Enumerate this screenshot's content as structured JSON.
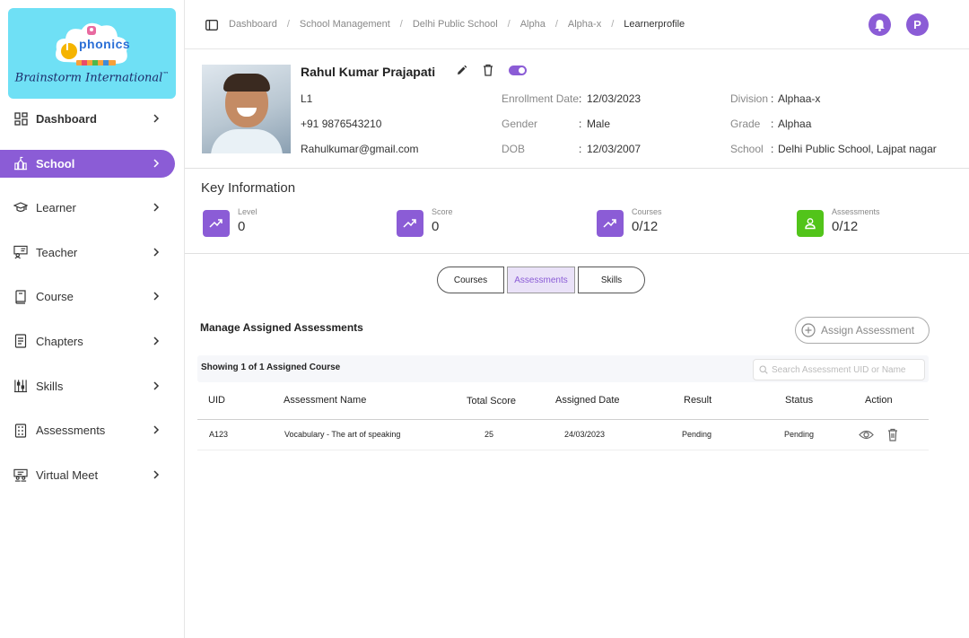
{
  "brand": {
    "logo_text": "phonics",
    "logo_initial": "I",
    "name": "Brainstorm International",
    "trademark": "™"
  },
  "sidebar": {
    "items": [
      {
        "label": "Dashboard",
        "icon": "dashboard-grid-icon"
      },
      {
        "label": "School",
        "icon": "school-building-icon",
        "active": true
      },
      {
        "label": "Learner",
        "icon": "graduation-cap-icon"
      },
      {
        "label": "Teacher",
        "icon": "teacher-board-icon"
      },
      {
        "label": "Course",
        "icon": "book-icon"
      },
      {
        "label": "Chapters",
        "icon": "document-icon"
      },
      {
        "label": "Skills",
        "icon": "abacus-icon"
      },
      {
        "label": "Assessments",
        "icon": "assessment-sheet-icon"
      },
      {
        "label": "Virtual Meet",
        "icon": "meeting-icon"
      }
    ]
  },
  "breadcrumb": {
    "items": [
      "Dashboard",
      "School Management",
      "Delhi Public School",
      "Alpha",
      "Alpha-x"
    ],
    "current": "Learnerprofile",
    "separator": "/"
  },
  "header": {
    "avatar_initial": "P"
  },
  "profile": {
    "name": "Rahul Kumar Prajapati",
    "level": "L1",
    "phone": "+91 9876543210",
    "email": "Rahulkumar@gmail.com",
    "enrollment_label": "Enrollment Date",
    "enrollment_value": "12/03/2023",
    "gender_label": "Gender",
    "gender_value": "Male",
    "dob_label": "DOB",
    "dob_value": "12/03/2007",
    "division_label": "Division",
    "division_value": "Alphaa-x",
    "grade_label": "Grade",
    "grade_value": "Alphaa",
    "school_label": "School",
    "school_value": "Delhi Public School, Lajpat nagar",
    "colon": ":",
    "active_toggle": true
  },
  "key_info": {
    "title": "Key Information",
    "stats": [
      {
        "label": "Level",
        "value": "0"
      },
      {
        "label": "Score",
        "value": "0"
      },
      {
        "label": "Courses",
        "value": "0/12"
      },
      {
        "label": "Assessments",
        "value": "0/12"
      }
    ]
  },
  "tabs": {
    "courses": "Courses",
    "assessments": "Assessments",
    "skills": "Skills",
    "selected": "Assessments"
  },
  "assessments": {
    "title": "Manage Assigned Assessments",
    "assign_button": "Assign Assessment",
    "showing": "Showing 1 of 1 Assigned Course",
    "search_placeholder": "Search Assessment UID or Name",
    "columns": {
      "uid": "UID",
      "name": "Assessment Name",
      "total_score": "Total Score",
      "assigned_date": "Assigned Date",
      "result": "Result",
      "status": "Status",
      "action": "Action"
    },
    "rows": [
      {
        "uid": "A123",
        "name": "Vocabulary - The art of speaking",
        "total_score": "25",
        "assigned_date": "24/03/2023",
        "result": "Pending",
        "status": "Pending"
      }
    ]
  },
  "colors": {
    "accent": "#8b5cd6",
    "success": "#52c41a",
    "logo_bg": "#6fe0f5"
  }
}
